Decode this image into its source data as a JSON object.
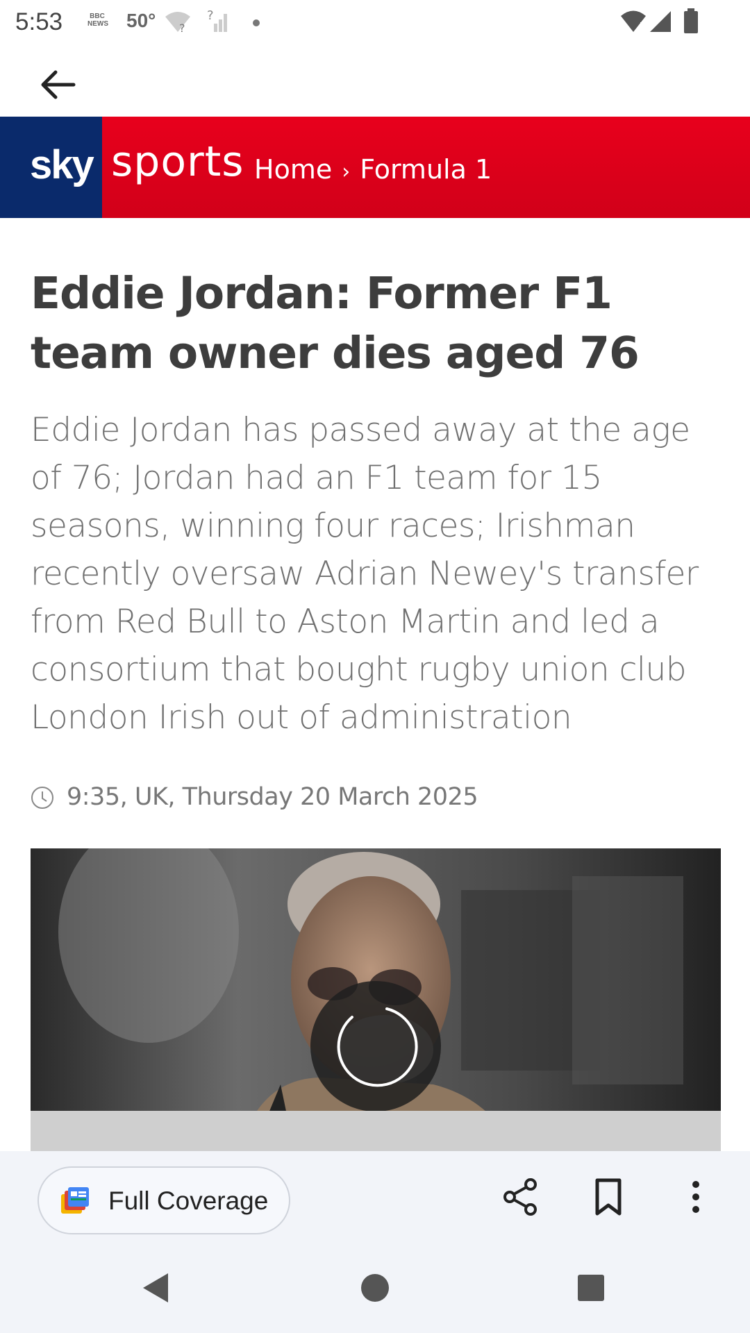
{
  "status_bar": {
    "time": "5:53",
    "bbc_news": "BBC NEWS",
    "temperature": "50°"
  },
  "app_bar": {
    "back_icon": "arrow-left-icon"
  },
  "banner": {
    "logo_sky": "sky",
    "logo_sports": "sports",
    "breadcrumb": [
      "Home",
      "Formula 1"
    ],
    "breadcrumb_separator": "›",
    "colors": {
      "red": "#e8001c",
      "navy": "#0a2a6b"
    }
  },
  "article": {
    "headline": "Eddie Jordan: Former F1 team owner dies aged 76",
    "summary": "Eddie Jordan has passed away at the age of 76; Jordan had an F1 team for 15 seasons, winning four races; Irishman recently oversaw Adrian Newey's transfer from Red Bull to Aston Martin and led a consortium that bought rugby union club London Irish out of administration",
    "timestamp": "9:35, UK, Thursday 20 March 2025"
  },
  "bottom_bar": {
    "full_coverage_label": "Full Coverage",
    "icons": [
      "share-icon",
      "bookmark-icon",
      "more-vert-icon"
    ]
  },
  "nav_bar": {
    "icons": [
      "back-triangle-icon",
      "home-circle-icon",
      "recents-square-icon"
    ]
  }
}
